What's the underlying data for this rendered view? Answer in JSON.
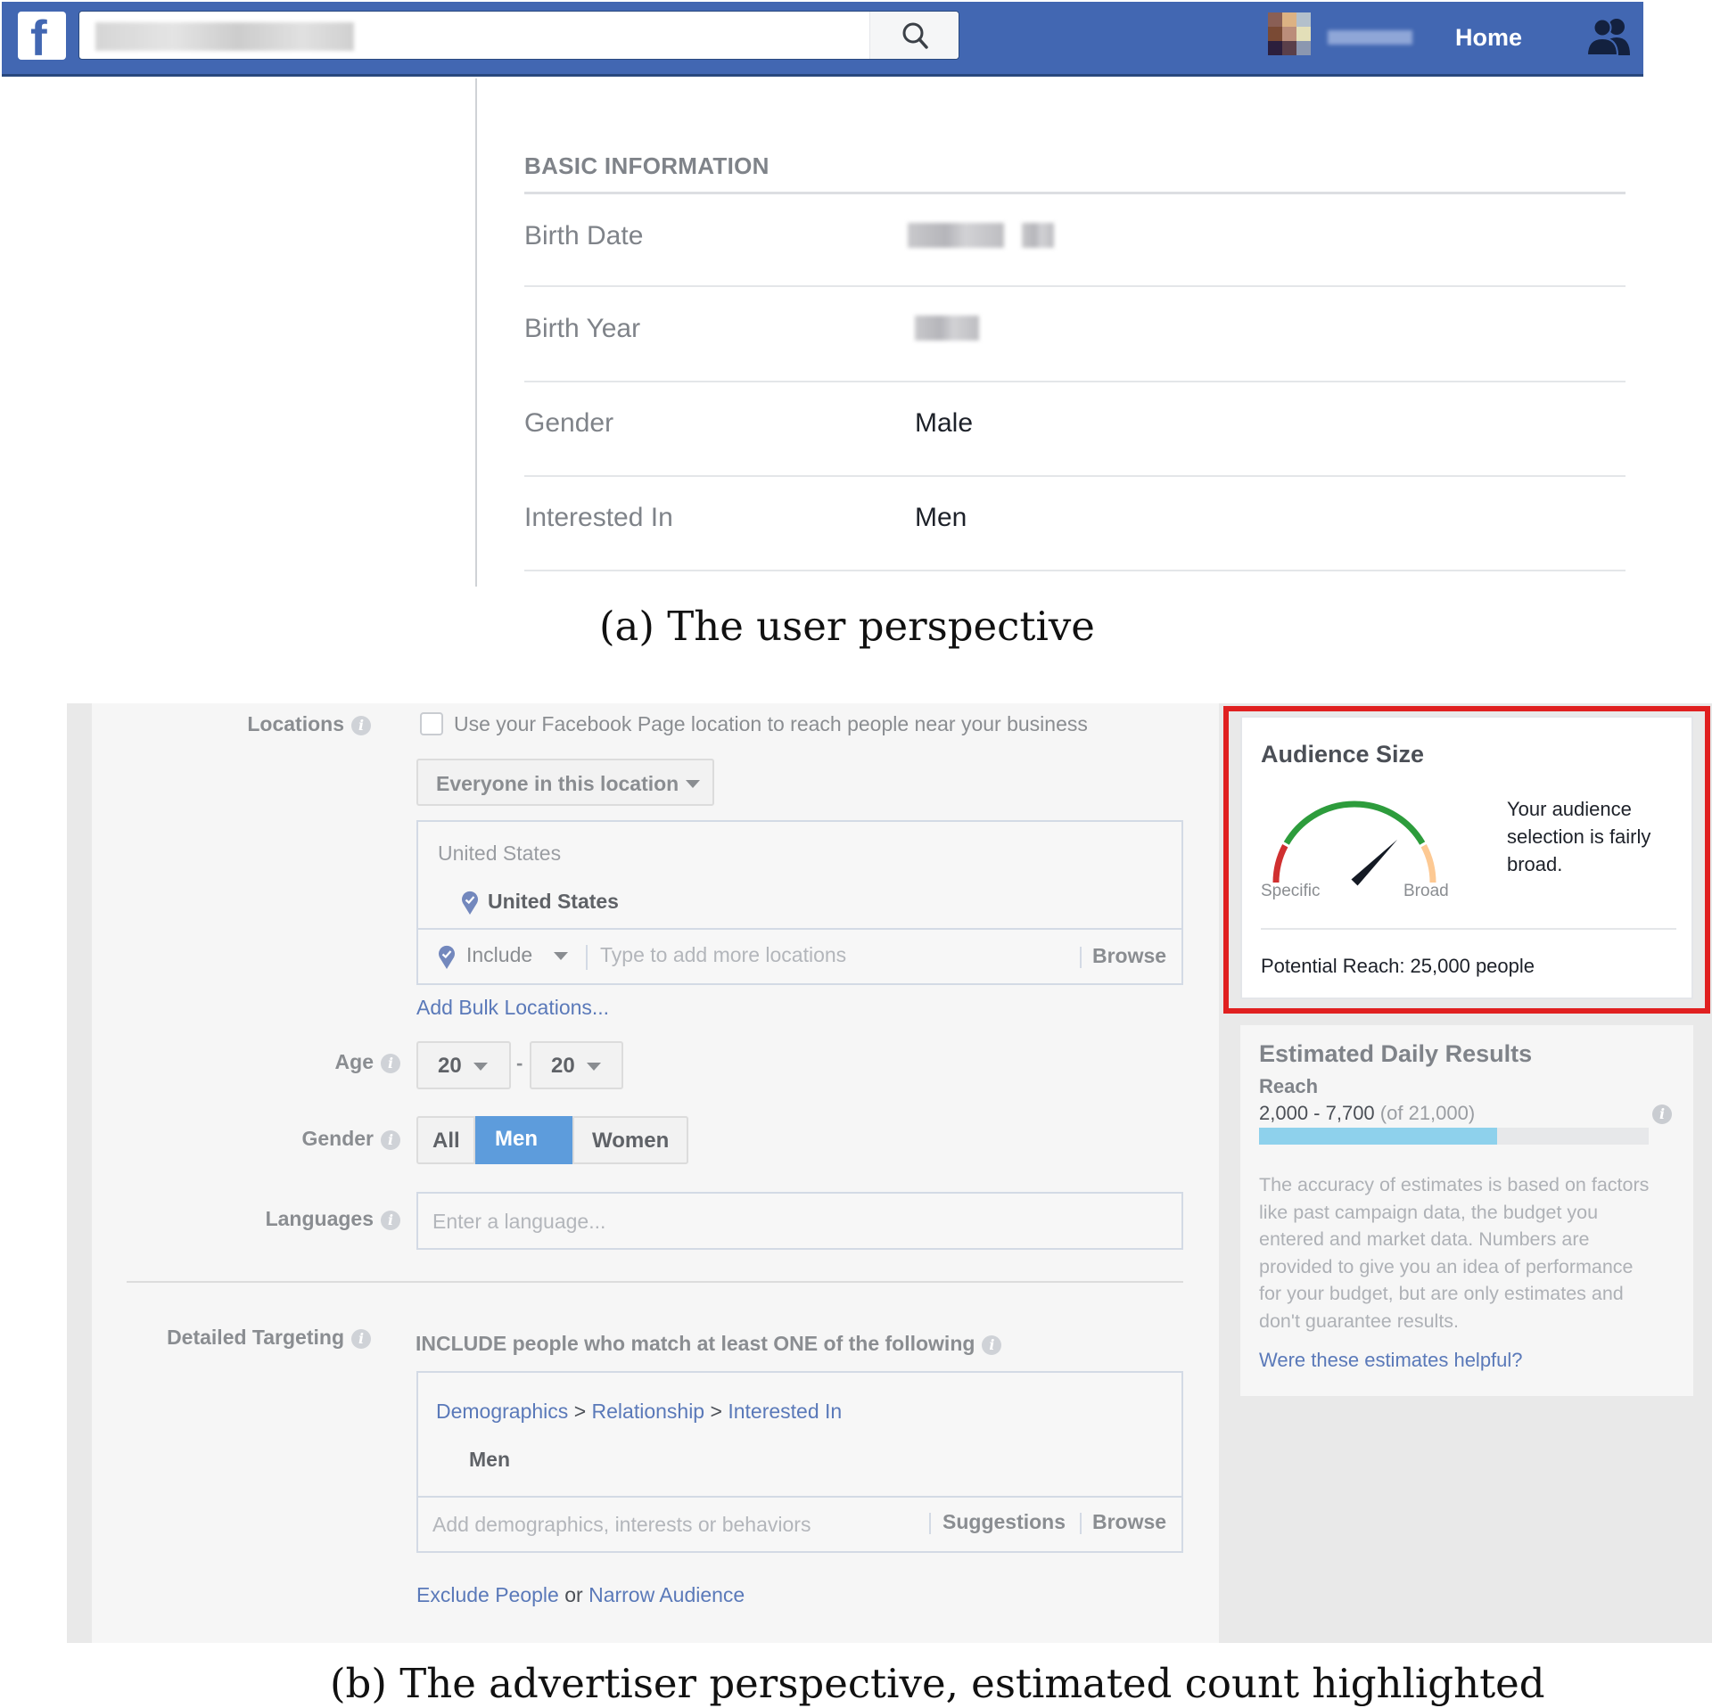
{
  "user_view": {
    "header": {
      "logo": "f",
      "search_value_blurred": true,
      "search_icon": "search-icon",
      "profile_name_blurred": true,
      "home_label": "Home",
      "friends_icon": "friend-requests-icon",
      "brand_color": "#4267b2"
    },
    "basic_info": {
      "title": "BASIC INFORMATION",
      "rows": [
        {
          "label": "Birth Date",
          "value": null,
          "blurred": true
        },
        {
          "label": "Birth Year",
          "value": null,
          "blurred": true
        },
        {
          "label": "Gender",
          "value": "Male",
          "blurred": false
        },
        {
          "label": "Interested In",
          "value": "Men",
          "blurred": false
        }
      ]
    },
    "caption": "(a) The user perspective"
  },
  "advertiser_view": {
    "locations": {
      "label": "Locations",
      "checkbox_label": "Use your Facebook Page location to reach people near your business",
      "checkbox_checked": false,
      "audience_dropdown": "Everyone in this location",
      "location_group_header": "United States",
      "selected_location": "United States",
      "include_dropdown": "Include",
      "add_location_placeholder": "Type to add more locations",
      "browse_label": "Browse",
      "bulk_link": "Add Bulk Locations..."
    },
    "age": {
      "label": "Age",
      "min": "20",
      "separator": "-",
      "max": "20"
    },
    "gender": {
      "label": "Gender",
      "options": [
        "All",
        "Men",
        "Women"
      ],
      "selected": "Men",
      "selected_color": "#5d9cdc"
    },
    "languages": {
      "label": "Languages",
      "placeholder": "Enter a language..."
    },
    "detailed_targeting": {
      "label": "Detailed Targeting",
      "include_text": "INCLUDE people who match at least ONE of the following",
      "breadcrumb": [
        "Demographics",
        "Relationship",
        "Interested In"
      ],
      "breadcrumb_sep": ">",
      "selected_value": "Men",
      "add_placeholder": "Add demographics, interests or behaviors",
      "suggestions_label": "Suggestions",
      "browse_label": "Browse",
      "exclude_link": "Exclude People",
      "or_text": "or",
      "narrow_link": "Narrow Audience"
    },
    "audience_size": {
      "title": "Audience Size",
      "gauge_left_label": "Specific",
      "gauge_right_label": "Broad",
      "gauge_level": 0.75,
      "description": "Your audience selection is fairly broad.",
      "potential_reach": "Potential Reach: 25,000 people",
      "highlight_color": "#e02020"
    },
    "estimated_results": {
      "title": "Estimated Daily Results",
      "metric": "Reach",
      "range": "2,000 - 7,700",
      "of_total": "(of 21,000)",
      "bar_fill_fraction": 0.61,
      "bar_color": "#8ed1ec",
      "disclaimer": "The accuracy of estimates is based on factors like past campaign data, the budget you entered and market data. Numbers are provided to give you an idea of performance for your budget, but are only estimates and don't guarantee results.",
      "feedback_link": "Were these estimates helpful?"
    },
    "caption": "(b) The advertiser perspective, estimated count highlighted"
  }
}
